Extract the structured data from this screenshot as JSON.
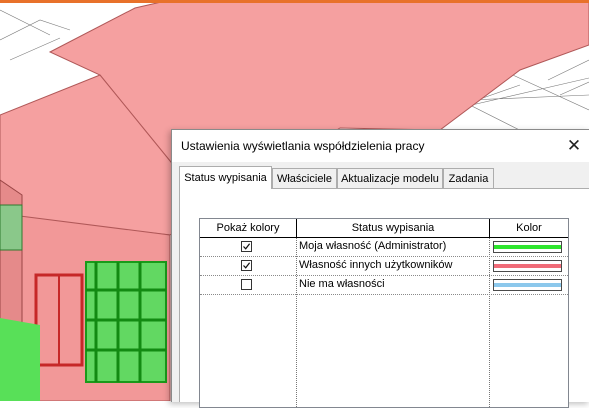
{
  "dialog": {
    "title": "Ustawienia wyświetlania współdzielenia pracy",
    "close_glyph": "✕"
  },
  "tabs": [
    {
      "label": "Status wypisania",
      "active": true
    },
    {
      "label": "Właściciele",
      "active": false
    },
    {
      "label": "Aktualizacje modelu",
      "active": false
    },
    {
      "label": "Zadania",
      "active": false
    }
  ],
  "table": {
    "headers": {
      "show_colors": "Pokaż kolory",
      "status": "Status wypisania",
      "color": "Kolor"
    },
    "rows": [
      {
        "checked": true,
        "label": "Moja własność (Administrator)",
        "color": "#2ee62e"
      },
      {
        "checked": true,
        "label": "Własność innych użytkowników",
        "color": "#f06b78"
      },
      {
        "checked": false,
        "label": "Nie ma własności",
        "color": "#8cc8ec"
      }
    ]
  },
  "colors": {
    "accent_bar": "#e8712a",
    "roof": "#f59a9a",
    "owned_green": "#2ecc2e",
    "model_gray": "#6e6e6e"
  }
}
